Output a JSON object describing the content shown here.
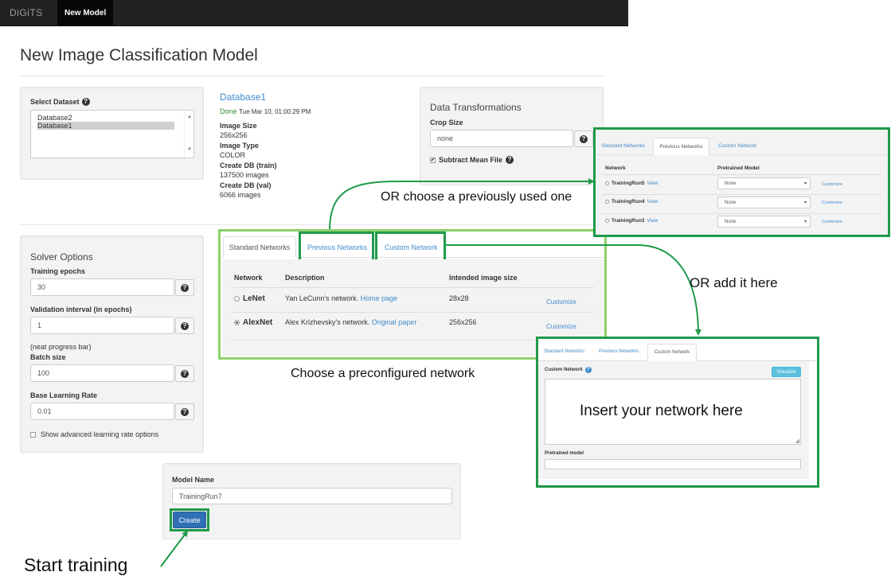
{
  "navbar": {
    "brand": "DiGiTS",
    "tab": "New Model"
  },
  "page_title": "New Image Classification Model",
  "dataset_panel": {
    "label": "Select Dataset",
    "options": [
      "Database2",
      "Database1"
    ],
    "selected": "Database1"
  },
  "dataset_info": {
    "name": "Database1",
    "status": "Done",
    "timestamp": "Tue Mar 10, 01:00:29 PM",
    "image_size_label": "Image Size",
    "image_size": "256x256",
    "image_type_label": "Image Type",
    "image_type": "COLOR",
    "train_label": "Create DB (train)",
    "train_value": "137500 images",
    "val_label": "Create DB (val)",
    "val_value": "6066 images"
  },
  "transformations": {
    "title": "Data Transformations",
    "crop_label": "Crop Size",
    "crop_placeholder": "none",
    "subtract_label": "Subtract Mean File"
  },
  "solver": {
    "title": "Solver Options",
    "epochs_label": "Training epochs",
    "epochs_value": "30",
    "validation_label": "Validation interval (in epochs)",
    "validation_value": "1",
    "note": "(neat progress bar)",
    "batch_label": "Batch size",
    "batch_value": "100",
    "lr_label": "Base Learning Rate",
    "lr_value": "0.01",
    "advanced_label": "Show advanced learning rate options"
  },
  "networks": {
    "tabs": [
      "Standard Networks",
      "Previous Networks",
      "Custom Network"
    ],
    "columns": [
      "Network",
      "Description",
      "Intended image size"
    ],
    "rows": [
      {
        "name": "LeNet",
        "description": "Yan LeCunn's network.",
        "link": "Home page",
        "size": "28x28",
        "action": "Customize",
        "selected": false
      },
      {
        "name": "AlexNet",
        "description": "Alex Krizhevsky's network.",
        "link": "Original paper",
        "size": "256x256",
        "action": "Customize",
        "selected": true
      }
    ]
  },
  "previous_panel": {
    "tabs": [
      "Standard Networks",
      "Previous Networks",
      "Custom Network"
    ],
    "columns": [
      "Network",
      "Pretrained Model"
    ],
    "rows": [
      {
        "name": "TrainingRun5",
        "link": "View",
        "model": "None",
        "action": "Customize"
      },
      {
        "name": "TrainingRun4",
        "link": "View",
        "model": "None",
        "action": "Customize"
      },
      {
        "name": "TrainingRun3",
        "link": "View",
        "model": "None",
        "action": "Customize"
      }
    ]
  },
  "custom_panel": {
    "tabs": [
      "Standard Networks",
      "Previous Networks",
      "Custom Network"
    ],
    "field_label": "Custom Network",
    "visualize": "Visualize",
    "pretrained_label": "Pretrained model"
  },
  "model_name": {
    "label": "Model Name",
    "value": "TrainingRun7",
    "create": "Create"
  },
  "annotations": {
    "previous": "OR choose a previously used one",
    "add": "OR add it here",
    "preconfigured": "Choose a preconfigured network",
    "insert": "Insert your network here",
    "start": "Start training"
  },
  "colors": {
    "highlight_green": "#1f9a4a",
    "light_green": "#8bd16a",
    "link_blue": "#428bca"
  }
}
